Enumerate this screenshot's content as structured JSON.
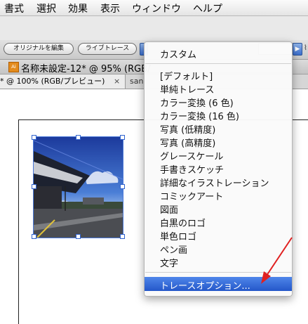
{
  "menubar": {
    "items": [
      "書式",
      "選択",
      "効果",
      "表示",
      "ウィンドウ",
      "ヘルプ"
    ]
  },
  "controlbar": {
    "edit_original_label": "オリジナルを編集",
    "live_trace_label": "ライブトレース"
  },
  "document": {
    "title": "名称未設定-12* @ 95% (RGB/",
    "tab_active": "* @ 100% (RGB/プレビュー)",
    "tab_close": "×",
    "tab_next": "san"
  },
  "trace_menu": {
    "header": "カスタム",
    "presets": [
      "[デフォルト]",
      "単純トレース",
      "カラー変換 (6 色)",
      "カラー変換 (16 色)",
      "写真 (低精度)",
      "写真 (高精度)",
      "グレースケール",
      "手書きスケッチ",
      "詳細なイラストレーション",
      "コミックアート",
      "図面",
      "白黒のロゴ",
      "単色ロゴ",
      "ペン画",
      "文字"
    ],
    "options_label": "トレースオプション..."
  },
  "colors": {
    "selection_blue": "#2f62cf",
    "annotation_arrow": "#e02020",
    "highlight": "#2d63d6"
  }
}
